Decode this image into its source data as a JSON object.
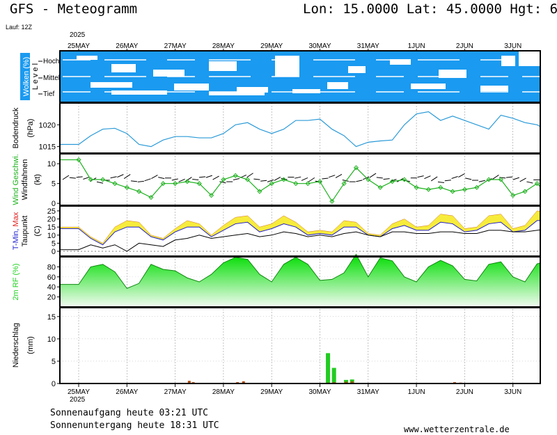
{
  "header": {
    "title": "GFS - Meteogramm",
    "coords": "Lon: 15.0000  Lat: 45.0000  Hgt: 6",
    "run": "Lauf: 12Z",
    "year": "2025"
  },
  "footer": {
    "sunrise": "Sonnenaufgang heute 03:21 UTC",
    "sunset": "Sonnenuntergang heute 18:31 UTC",
    "website": "www.wetterzentrale.de"
  },
  "colors": {
    "cloud_bg": "#1a9af0",
    "pressure": "#2a9ad8",
    "wind_line": "#1db11d",
    "temp_fill_low": "#f7e83a",
    "temp_fill_high": "#e85020",
    "tmin": "#2020d0",
    "tmax": "#e02020",
    "humidity": "#22d222",
    "precip_conv": "#22cc22",
    "precip_large": "#b04a10"
  },
  "chart_data": [
    {
      "type": "heatmap",
      "panel": "clouds",
      "ylabel": "Wolken (%)",
      "ylabel2": "L e v e l",
      "levels": [
        "Hoch",
        "Mittel",
        "Tief"
      ],
      "x_days": [
        "25MAY",
        "26MAY",
        "27MAY",
        "28MAY",
        "29MAY",
        "30MAY",
        "31MAY",
        "1JUN",
        "2JUN",
        "3JUN"
      ]
    },
    {
      "type": "line",
      "panel": "pressure",
      "ylabel": "Bodendruck",
      "ylabel2": "(hPa)",
      "yticks": [
        1015,
        1020
      ],
      "ylim": [
        1013.5,
        1025
      ],
      "x_hours": [
        0,
        6,
        12,
        18,
        24,
        30,
        36,
        42,
        48,
        54,
        60,
        66,
        72,
        78,
        84,
        90,
        96,
        102,
        108,
        114,
        120,
        126,
        132,
        138,
        144,
        150,
        156,
        162,
        168,
        174,
        180,
        186,
        192,
        198,
        204,
        210,
        216,
        222,
        228,
        234,
        240,
        246,
        252,
        258
      ],
      "values": [
        1015.5,
        1017.5,
        1019.0,
        1019.2,
        1018.0,
        1015.5,
        1015.0,
        1016.5,
        1017.3,
        1017.3,
        1017.0,
        1017.0,
        1018.0,
        1020.0,
        1020.5,
        1019.0,
        1018.0,
        1019.0,
        1021.0,
        1021.0,
        1021.3,
        1019.0,
        1017.5,
        1015.0,
        1016.0,
        1016.3,
        1016.5,
        1020.0,
        1022.5,
        1023.0,
        1021.0,
        1022.0,
        1021.0,
        1020.0,
        1019.0,
        1022.2,
        1021.5,
        1020.5,
        1020.0,
        1018.5,
        1018.5,
        1017.3,
        1017.8,
        1015.5
      ]
    },
    {
      "type": "line",
      "panel": "wind",
      "ylabel": "Wind Geschwi.",
      "ylabel2": "Windfahnen",
      "ylabel3": "(kt)",
      "yticks": [
        0,
        5,
        10
      ],
      "ylim": [
        -0.5,
        12.5
      ],
      "x_hours": [
        0,
        6,
        12,
        18,
        24,
        30,
        36,
        42,
        48,
        54,
        60,
        66,
        72,
        78,
        84,
        90,
        96,
        102,
        108,
        114,
        120,
        126,
        132,
        138,
        144,
        150,
        156,
        162,
        168,
        174,
        180,
        186,
        192,
        198,
        204,
        210,
        216,
        222,
        228,
        234,
        240,
        246,
        252,
        258
      ],
      "values": [
        11,
        6,
        6,
        5,
        4,
        3,
        1.5,
        5,
        5,
        5.5,
        5,
        2,
        6,
        7,
        6,
        3,
        5,
        6,
        5,
        5,
        5.5,
        0.5,
        5,
        9,
        6,
        4,
        5.5,
        6,
        4,
        3.5,
        4,
        3,
        3.5,
        4,
        6,
        6,
        2,
        3,
        5,
        2,
        3,
        3,
        1.5,
        5
      ]
    },
    {
      "type": "area",
      "panel": "temperature",
      "ylabel": "T-Min, Max",
      "ylabel_tmin": "T-Min,",
      "ylabel_tmax": "Max",
      "ylabel2": "Taupunkt",
      "ylabel3": "(C)",
      "yticks": [
        0,
        5,
        10,
        15,
        20,
        25
      ],
      "ylim": [
        -3,
        28
      ],
      "x_hours": [
        0,
        6,
        12,
        18,
        24,
        30,
        36,
        42,
        48,
        54,
        60,
        66,
        72,
        78,
        84,
        90,
        96,
        102,
        108,
        114,
        120,
        126,
        132,
        138,
        144,
        150,
        156,
        162,
        168,
        174,
        180,
        186,
        192,
        198,
        204,
        210,
        216,
        222,
        228,
        234,
        240,
        246,
        252,
        258
      ],
      "series": [
        {
          "name": "T-Max",
          "values": [
            15,
            9,
            5,
            15,
            19,
            18,
            10,
            8,
            14,
            19,
            17,
            10,
            16,
            21,
            22,
            15,
            17,
            22,
            18,
            12,
            13,
            12,
            19,
            18,
            11,
            10,
            17,
            20,
            15,
            16,
            23,
            22,
            14,
            15,
            22,
            23,
            14,
            16,
            25,
            24,
            15,
            14,
            24,
            24
          ]
        },
        {
          "name": "T-Min",
          "values": [
            14,
            8,
            4,
            12,
            15,
            15,
            9,
            7,
            12,
            15,
            15,
            9,
            13,
            17,
            18,
            12,
            14,
            17,
            15,
            10,
            11,
            10,
            15,
            15,
            10,
            9,
            14,
            16,
            13,
            13,
            18,
            17,
            12,
            13,
            17,
            18,
            12,
            13,
            19,
            19,
            13,
            12,
            18,
            18
          ]
        },
        {
          "name": "Taupunkt",
          "values": [
            1,
            4,
            2,
            4,
            0,
            5,
            4,
            3,
            7,
            8,
            10,
            8,
            9,
            10,
            11,
            9,
            10,
            12,
            11,
            9,
            10,
            9,
            11,
            12,
            10,
            9,
            12,
            12,
            11,
            11,
            12,
            12,
            11,
            11,
            13,
            13,
            12,
            12,
            13,
            14,
            13,
            12,
            14,
            13
          ]
        }
      ]
    },
    {
      "type": "area",
      "panel": "humidity",
      "ylabel": "2m RF (%)",
      "yticks": [
        20,
        40,
        60,
        80
      ],
      "ylim": [
        0,
        100
      ],
      "x_hours": [
        0,
        6,
        12,
        18,
        24,
        30,
        36,
        42,
        48,
        54,
        60,
        66,
        72,
        78,
        84,
        90,
        96,
        102,
        108,
        114,
        120,
        126,
        132,
        138,
        144,
        150,
        156,
        162,
        168,
        174,
        180,
        186,
        192,
        198,
        204,
        210,
        216,
        222,
        228,
        234,
        240,
        246,
        252,
        258
      ],
      "values": [
        45,
        80,
        85,
        70,
        37,
        47,
        85,
        75,
        72,
        58,
        50,
        65,
        88,
        99,
        95,
        65,
        50,
        85,
        99,
        85,
        53,
        55,
        68,
        105,
        60,
        98,
        92,
        60,
        50,
        80,
        93,
        82,
        55,
        52,
        85,
        90,
        60,
        50,
        86,
        92,
        72,
        50,
        88,
        55
      ]
    },
    {
      "type": "bar",
      "panel": "precipitation",
      "ylabel": "Niederschlag",
      "ylabel2": "(mm)",
      "yticks": [
        0,
        5,
        10,
        15
      ],
      "ylim": [
        0,
        17
      ],
      "bars": [
        {
          "hour": 55,
          "conv": 0.0,
          "large": 0.6
        },
        {
          "hour": 57,
          "conv": 0.0,
          "large": 0.3
        },
        {
          "hour": 79,
          "conv": 0.0,
          "large": 0.3
        },
        {
          "hour": 82,
          "conv": 0.0,
          "large": 0.5
        },
        {
          "hour": 121,
          "conv": 0.1,
          "large": 0.1
        },
        {
          "hour": 124,
          "conv": 6.8,
          "large": 0.2
        },
        {
          "hour": 127,
          "conv": 3.5,
          "large": 0.3
        },
        {
          "hour": 133,
          "conv": 0.8,
          "large": 0.4
        },
        {
          "hour": 136,
          "conv": 0.9,
          "large": 0.5
        },
        {
          "hour": 187,
          "conv": 0.0,
          "large": 0.3
        },
        {
          "hour": 190,
          "conv": 0.0,
          "large": 0.2
        }
      ]
    }
  ],
  "bottom_axis": {
    "days": [
      "25MAY",
      "26MAY",
      "27MAY",
      "28MAY",
      "29MAY",
      "30MAY",
      "31MAY",
      "1JUN",
      "2JUN",
      "3JUN"
    ],
    "year": "2025"
  }
}
